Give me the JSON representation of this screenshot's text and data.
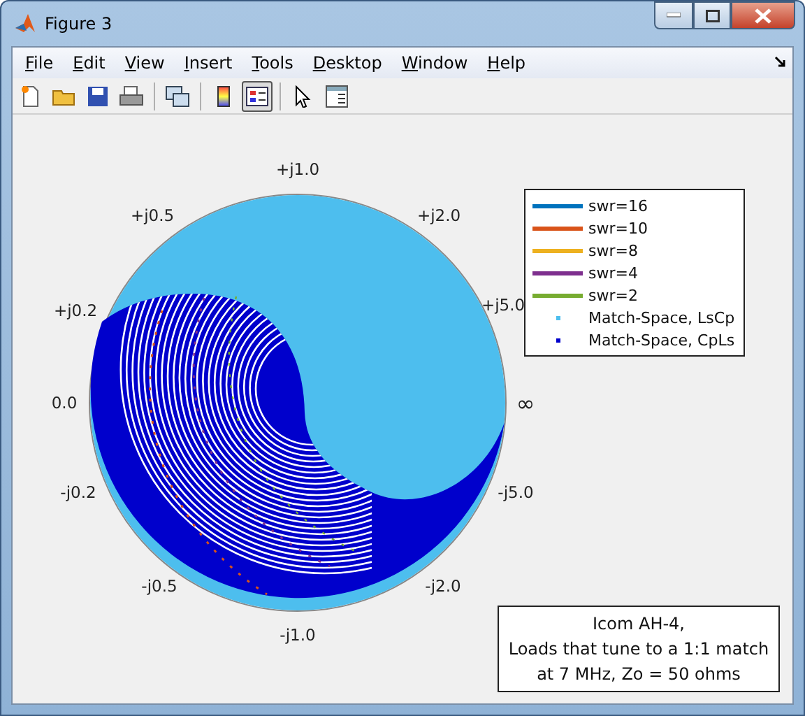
{
  "window": {
    "title": "Figure 3"
  },
  "menu": [
    {
      "label": "File"
    },
    {
      "label": "Edit"
    },
    {
      "label": "View"
    },
    {
      "label": "Insert"
    },
    {
      "label": "Tools"
    },
    {
      "label": "Desktop"
    },
    {
      "label": "Window"
    },
    {
      "label": "Help"
    }
  ],
  "toolbar": [
    {
      "kind": "new",
      "pressed": false
    },
    {
      "kind": "open",
      "pressed": false
    },
    {
      "kind": "save",
      "pressed": false
    },
    {
      "kind": "print",
      "pressed": false
    },
    {
      "kind": "sep"
    },
    {
      "kind": "link",
      "pressed": false
    },
    {
      "kind": "sep"
    },
    {
      "kind": "colorbar",
      "pressed": false
    },
    {
      "kind": "legend",
      "pressed": true
    },
    {
      "kind": "sep"
    },
    {
      "kind": "pointer",
      "pressed": false
    },
    {
      "kind": "panel",
      "pressed": false
    }
  ],
  "smith_chart": {
    "labels": [
      "+j1.0",
      "+j0.5",
      "+j2.0",
      "+j0.2",
      "+j5.0",
      "0.0",
      "∞",
      "-j0.2",
      "-j5.0",
      "-j0.5",
      "-j2.0",
      "-j1.0"
    ]
  },
  "legend": {
    "entries": [
      {
        "label": "swr=16",
        "kind": "line",
        "color": "#0072bd"
      },
      {
        "label": "swr=10",
        "kind": "line",
        "color": "#d95319"
      },
      {
        "label": "swr=8",
        "kind": "line",
        "color": "#edb120"
      },
      {
        "label": "swr=4",
        "kind": "line",
        "color": "#7e2f8e"
      },
      {
        "label": "swr=2",
        "kind": "line",
        "color": "#77ac30"
      },
      {
        "label": "Match-Space, LsCp",
        "kind": "marker",
        "color": "#4dbeee"
      },
      {
        "label": "Match-Space, CpLs",
        "kind": "marker",
        "color": "#0000cc"
      }
    ]
  },
  "annotation": {
    "lines": [
      "Icom AH-4,",
      "Loads that tune to a 1:1 match",
      "at 7 MHz, Zo = 50 ohms"
    ]
  }
}
